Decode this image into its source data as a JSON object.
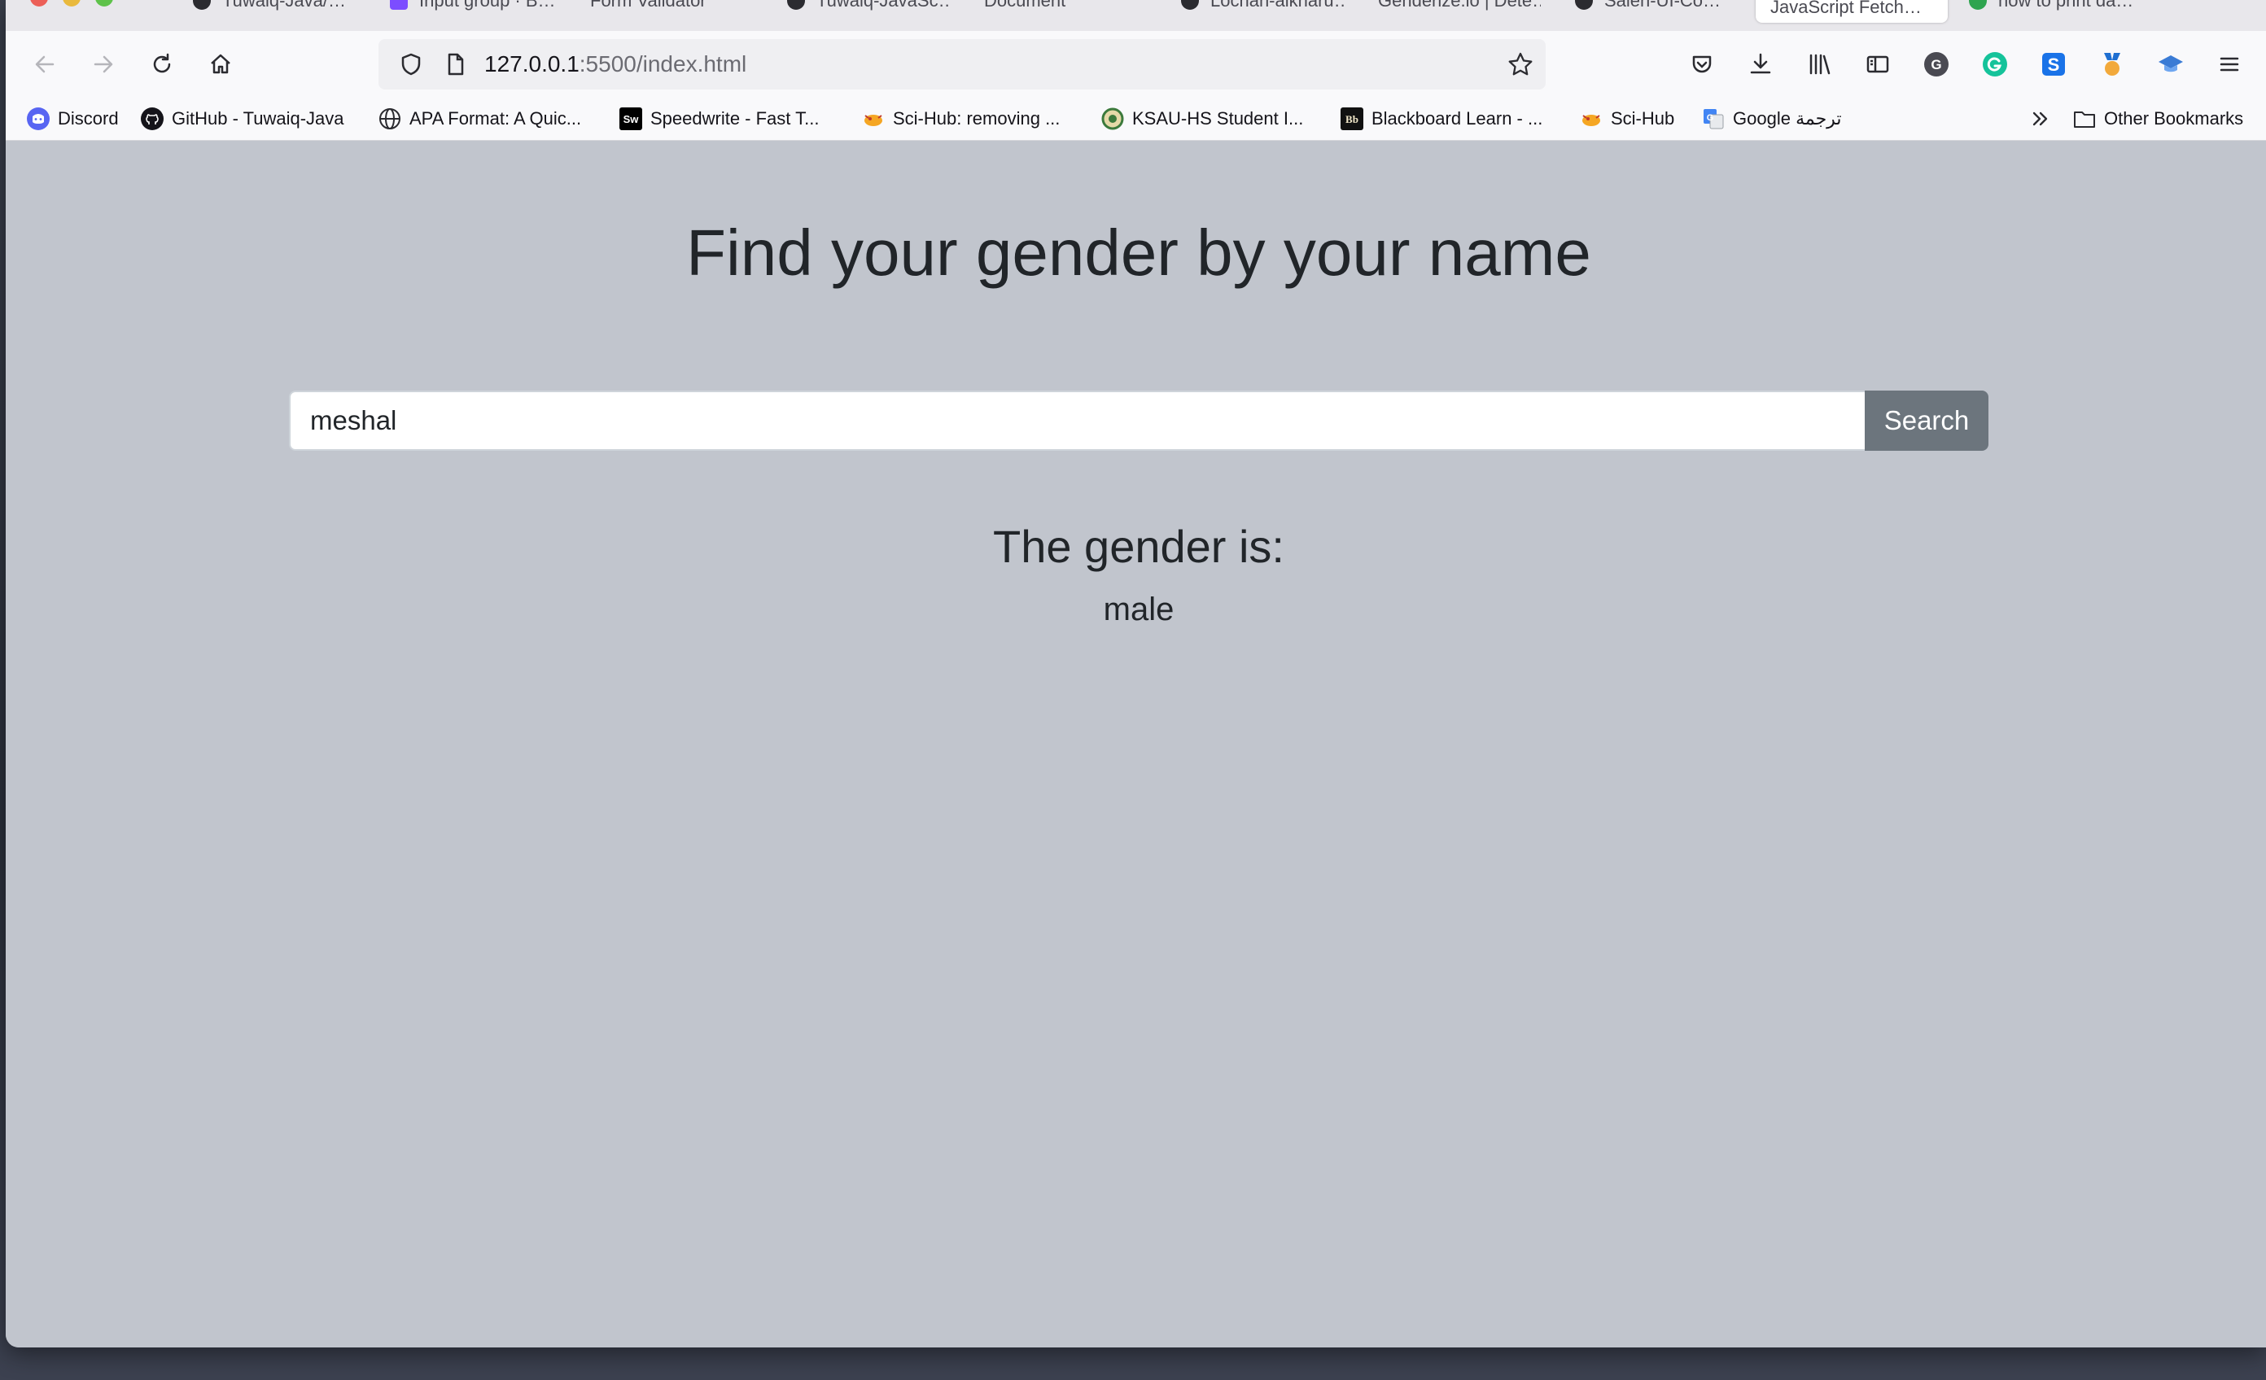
{
  "browser": {
    "tabs": [
      {
        "label": "Tuwaiq-Java/…",
        "icon": "github-icon"
      },
      {
        "label": "Input group · B…",
        "icon": "bootstrap-icon"
      },
      {
        "label": "Form Validator",
        "icon": "none"
      },
      {
        "label": "Tuwaiq-JavaSc…",
        "icon": "github-icon"
      },
      {
        "label": "Document",
        "icon": "none"
      },
      {
        "label": "Lochan-alkharu…",
        "icon": "github-icon"
      },
      {
        "label": "Genderize.io | Dete…",
        "icon": "none"
      },
      {
        "label": "Saleh-UI-Co…",
        "icon": "github-icon"
      },
      {
        "label": "JavaScript Fetch…",
        "icon": "none",
        "active": true
      },
      {
        "label": "how to print da…",
        "icon": "green-circle-icon"
      }
    ],
    "url": {
      "host": "127.0.0.1",
      "path": ":5500/index.html"
    },
    "bookmarks": [
      {
        "label": "Discord",
        "icon": "discord-icon"
      },
      {
        "label": "GitHub - Tuwaiq-Java",
        "icon": "github-icon"
      },
      {
        "label": "APA Format: A Quic...",
        "icon": "globe-icon"
      },
      {
        "label": "Speedwrite - Fast T...",
        "icon": "speedwrite-icon"
      },
      {
        "label": "Sci-Hub: removing ...",
        "icon": "scihub-icon"
      },
      {
        "label": "KSAU-HS Student I...",
        "icon": "ksau-icon"
      },
      {
        "label": "Blackboard Learn - ...",
        "icon": "blackboard-icon"
      },
      {
        "label": "Sci-Hub",
        "icon": "scihub-icon"
      },
      {
        "label": "Google ترجمة",
        "icon": "google-translate-icon"
      }
    ],
    "other_bookmarks": "Other Bookmarks"
  },
  "page": {
    "title": "Find your gender by your name",
    "search": {
      "value": "meshal",
      "button_label": "Search"
    },
    "result": {
      "heading": "The gender is:",
      "value": "male"
    }
  },
  "colors": {
    "page_background": "#c1c5cd",
    "button": "#6c757d",
    "text": "#212529"
  }
}
